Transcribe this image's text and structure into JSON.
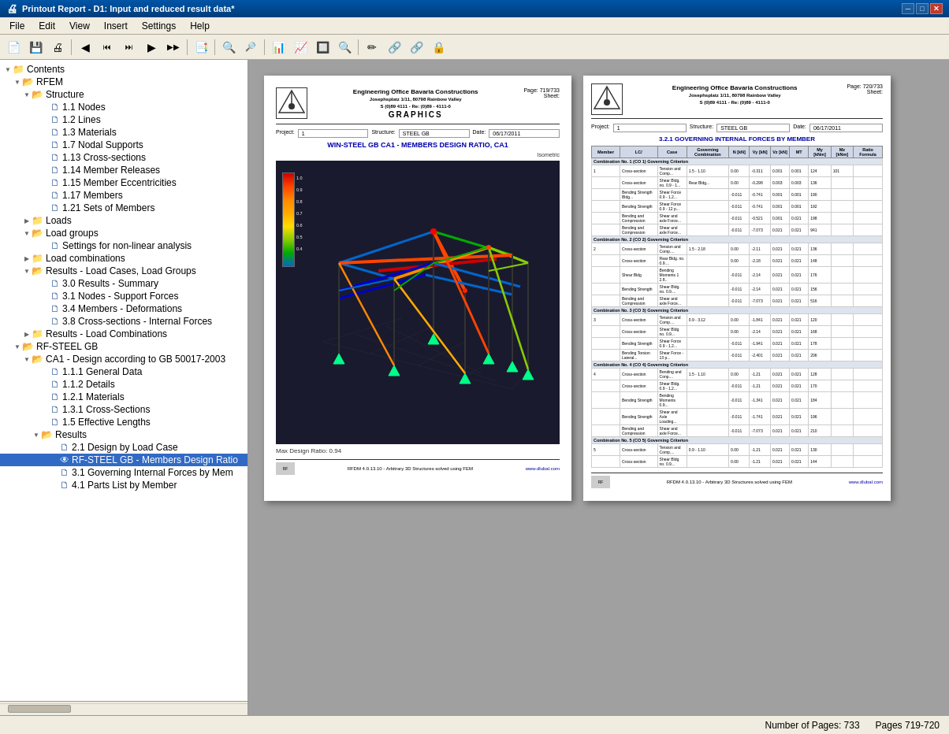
{
  "titleBar": {
    "title": "Printout Report - D1: Input and reduced result data*",
    "buttons": [
      "─",
      "□",
      "✕"
    ]
  },
  "menuBar": {
    "items": [
      "File",
      "Edit",
      "View",
      "Insert",
      "Settings",
      "Help"
    ]
  },
  "toolbar": {
    "groups": [
      [
        "📄",
        "💾",
        "🖨",
        "📋"
      ],
      [
        "◀",
        "◀◀",
        "⏮",
        "▶▶",
        "▶"
      ],
      [
        "📑"
      ],
      [
        "🔍+",
        "🔍-"
      ],
      [
        "📊",
        "📈",
        "🔲",
        "🔍"
      ],
      [
        "✏",
        "🔗",
        "🔗",
        "🔒"
      ]
    ]
  },
  "tree": {
    "items": [
      {
        "id": "contents",
        "label": "Contents",
        "level": 0,
        "type": "root",
        "expanded": true
      },
      {
        "id": "rfem",
        "label": "RFEM",
        "level": 1,
        "type": "open-folder",
        "expanded": true
      },
      {
        "id": "structure",
        "label": "Structure",
        "level": 2,
        "type": "open-folder",
        "expanded": true
      },
      {
        "id": "nodes",
        "label": "1.1 Nodes",
        "level": 3,
        "type": "doc"
      },
      {
        "id": "lines",
        "label": "1.2 Lines",
        "level": 3,
        "type": "doc"
      },
      {
        "id": "materials",
        "label": "1.3 Materials",
        "level": 3,
        "type": "doc"
      },
      {
        "id": "supports",
        "label": "1.7 Nodal Supports",
        "level": 3,
        "type": "doc"
      },
      {
        "id": "crosssections",
        "label": "1.13 Cross-sections",
        "level": 3,
        "type": "doc"
      },
      {
        "id": "releases",
        "label": "1.14 Member Releases",
        "level": 3,
        "type": "doc"
      },
      {
        "id": "eccentricities",
        "label": "1.15 Member Eccentricities",
        "level": 3,
        "type": "doc"
      },
      {
        "id": "members",
        "label": "1.17 Members",
        "level": 3,
        "type": "doc"
      },
      {
        "id": "sets",
        "label": "1.21 Sets of Members",
        "level": 3,
        "type": "doc"
      },
      {
        "id": "loads",
        "label": "Loads",
        "level": 2,
        "type": "folder",
        "expanded": false
      },
      {
        "id": "loadgroups",
        "label": "Load groups",
        "level": 2,
        "type": "open-folder",
        "expanded": true
      },
      {
        "id": "nonlinear",
        "label": "Settings for non-linear analysis",
        "level": 3,
        "type": "doc"
      },
      {
        "id": "loadcombinations",
        "label": "Load combinations",
        "level": 2,
        "type": "folder",
        "expanded": false
      },
      {
        "id": "resultslcg",
        "label": "Results - Load Cases, Load Groups",
        "level": 2,
        "type": "open-folder",
        "expanded": true
      },
      {
        "id": "summary",
        "label": "3.0 Results - Summary",
        "level": 3,
        "type": "doc"
      },
      {
        "id": "supportforces",
        "label": "3.1 Nodes - Support Forces",
        "level": 3,
        "type": "doc"
      },
      {
        "id": "deformations",
        "label": "3.4 Members - Deformations",
        "level": 3,
        "type": "doc"
      },
      {
        "id": "internalforces",
        "label": "3.8 Cross-sections - Internal Forces",
        "level": 3,
        "type": "doc"
      },
      {
        "id": "resultslc",
        "label": "Results - Load Combinations",
        "level": 2,
        "type": "folder",
        "expanded": false
      },
      {
        "id": "rfsteelgb",
        "label": "RF-STEEL GB",
        "level": 1,
        "type": "open-folder",
        "expanded": true
      },
      {
        "id": "ca1",
        "label": "CA1 - Design according to GB 50017-2003",
        "level": 2,
        "type": "open-folder",
        "expanded": true
      },
      {
        "id": "generaldata",
        "label": "1.1.1 General Data",
        "level": 3,
        "type": "doc"
      },
      {
        "id": "details",
        "label": "1.1.2 Details",
        "level": 3,
        "type": "doc"
      },
      {
        "id": "materials2",
        "label": "1.2.1 Materials",
        "level": 3,
        "type": "doc"
      },
      {
        "id": "crosssections2",
        "label": "1.3.1 Cross-Sections",
        "level": 3,
        "type": "doc"
      },
      {
        "id": "effectivelengths",
        "label": "1.5 Effective Lengths",
        "level": 3,
        "type": "doc"
      },
      {
        "id": "results-folder",
        "label": "Results",
        "level": 3,
        "type": "open-folder",
        "expanded": true
      },
      {
        "id": "designbyloadcase",
        "label": "2.1 Design by Load Case",
        "level": 4,
        "type": "doc"
      },
      {
        "id": "membersdesignratio",
        "label": "RF-STEEL GB - Members Design Ratio",
        "level": 4,
        "type": "doc-eye",
        "selected": true
      },
      {
        "id": "governingforces",
        "label": "3.1 Governing Internal Forces by Mem",
        "level": 4,
        "type": "doc"
      },
      {
        "id": "partslist",
        "label": "4.1 Parts List by Member",
        "level": 4,
        "type": "doc"
      }
    ]
  },
  "pages": {
    "left": {
      "pageNum": "719/733",
      "sheetNum": "",
      "company": "Engineering Office Bavaria Constructions",
      "address": "Josephsplatz 1/11, 80798 Rainbow Valley",
      "phone": "S (0)89 4111 - Re: (0)89 - 4111-0",
      "title": "GRAPHICS",
      "project": "1",
      "structure": "STEEL GB",
      "date": "06/17/2011",
      "sectionTitle": "WIN-STEEL GB CA1 - MEMBERS DESIGN RATIO, CA1",
      "subtitle": "Isometric",
      "maxDesignRatio": "Max Design Ratio: 0.94",
      "footer": "RFDM 4.0.13.10 - Arbitrary 3D Structures solved using FEM",
      "footerUrl": "www.dlubal.com"
    },
    "right": {
      "pageNum": "720/733",
      "sheetNum": "",
      "company": "Engineering Office Bavaria Constructions",
      "address": "Josephsplatz 1/11, 80798 Rainbow Valley",
      "phone": "S (0)89 4111 - Re: (0)89 - 4111-0",
      "project": "1",
      "structure": "STEEL GB",
      "date": "06/17/2011",
      "sectionTitle": "3.2.1 GOVERNING INTERNAL FORCES BY MEMBER",
      "footer": "RFDM 4.0.13.10 - Arbitrary 3D Structures solved using FEM",
      "footerUrl": "www.dlubal.com"
    }
  },
  "statusBar": {
    "numberOfPages": "Number of Pages: 733",
    "currentPages": "Pages 719-720"
  },
  "icons": {
    "folder": "📁",
    "openFolder": "📂",
    "document": "📄",
    "eye": "👁"
  }
}
